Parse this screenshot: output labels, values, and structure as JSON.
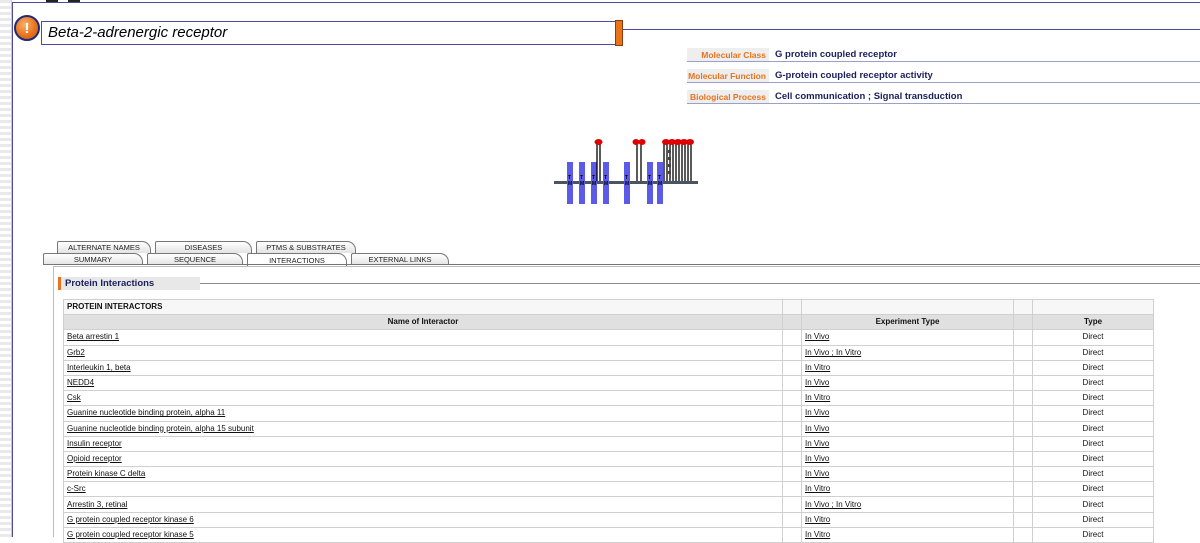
{
  "title": "Beta-2-adrenergic receptor",
  "info": [
    {
      "label": "Molecular Class",
      "value": "G protein coupled receptor"
    },
    {
      "label": "Molecular Function",
      "value": "G-protein coupled receptor activity"
    },
    {
      "label": "Biological Process",
      "value": "Cell communication ; Signal transduction"
    }
  ],
  "tabs_back": [
    "ALTERNATE NAMES",
    "DISEASES",
    "PTMs & SUBSTRATES"
  ],
  "tabs_front": [
    "SUMMARY",
    "SEQUENCE",
    "INTERACTIONS",
    "EXTERNAL LINKS"
  ],
  "active_tab": "INTERACTIONS",
  "panel_title": "Protein Interactions",
  "table": {
    "section": "PROTEIN INTERACTORS",
    "headers": [
      "Name of Interactor",
      "Experiment Type",
      "Type"
    ],
    "rows": [
      {
        "name": "Beta arrestin 1",
        "exp": "In Vivo",
        "type": "Direct"
      },
      {
        "name": "Grb2",
        "exp": "In Vivo ; In Vitro",
        "type": "Direct"
      },
      {
        "name": "Interleukin 1, beta",
        "exp": "In Vitro",
        "type": "Direct"
      },
      {
        "name": "NEDD4",
        "exp": "In Vivo",
        "type": "Direct"
      },
      {
        "name": "Csk",
        "exp": "In Vitro",
        "type": "Direct"
      },
      {
        "name": "Guanine nucleotide binding protein, alpha 11",
        "exp": "In Vivo",
        "type": "Direct"
      },
      {
        "name": "Guanine nucleotide binding protein, alpha 15 subunit",
        "exp": "In Vivo",
        "type": "Direct"
      },
      {
        "name": "Insulin receptor",
        "exp": "In Vivo",
        "type": "Direct"
      },
      {
        "name": "Opioid receptor",
        "exp": "In Vivo",
        "type": "Direct"
      },
      {
        "name": "Protein kinase C delta",
        "exp": "In Vivo",
        "type": "Direct"
      },
      {
        "name": "c-Src",
        "exp": "In Vitro",
        "type": "Direct"
      },
      {
        "name": "Arrestin 3, retinal",
        "exp": "In Vivo ; In Vitro",
        "type": "Direct"
      },
      {
        "name": "G protein coupled receptor kinase 6",
        "exp": "In Vitro",
        "type": "Direct"
      },
      {
        "name": "G protein coupled receptor kinase 5",
        "exp": "In Vitro",
        "type": "Direct"
      }
    ]
  },
  "colors": {
    "accent": "#e8731c",
    "navy": "#1a1f5c",
    "tm_segment": "#5b5be8",
    "ptm_site": "#e00000"
  },
  "icons": {
    "alert": "alert-icon"
  }
}
